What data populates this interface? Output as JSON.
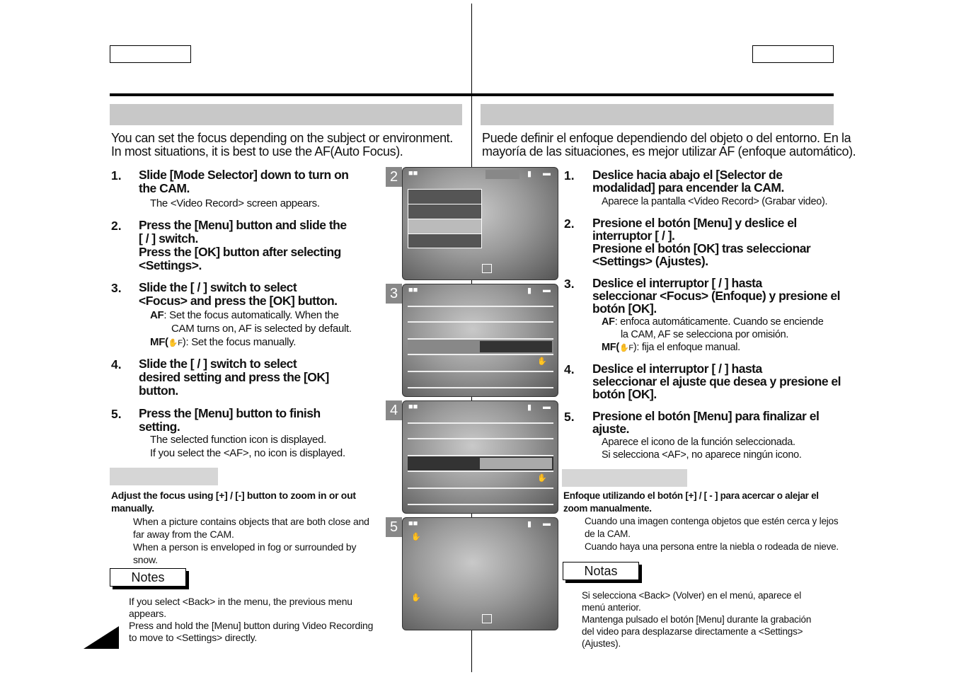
{
  "left": {
    "intro": "You can set the focus depending on the subject or environment.\nIn most situations, it is best to use the AF(Auto Focus).",
    "steps": [
      {
        "num": "1.",
        "text": "Slide [Mode Selector] down to turn on\nthe CAM.",
        "sub": "The <Video Record> screen appears."
      },
      {
        "num": "2.",
        "text": "Press the [Menu] button and slide the\n[    /    ] switch.\nPress the [OK] button after selecting\n<Settings>."
      },
      {
        "num": "3.",
        "text": "Slide the [    /    ] switch to select\n<Focus> and press the [OK] button.",
        "af_label": "AF",
        "af_text": ": Set the focus automatically. When the",
        "af_text2": "CAM turns on, AF is selected by default.",
        "mf_label": "MF(",
        "mf_text": "): Set the focus manually."
      },
      {
        "num": "4.",
        "text": "Slide the [    /    ] switch to select\ndesired setting and press the [OK]\nbutton."
      },
      {
        "num": "5.",
        "text": "Press the [Menu] button to finish\nsetting.",
        "sub": "The selected function icon is displayed.\nIf you select the <AF>, no icon is displayed."
      }
    ],
    "mf_heading": "Adjust the focus using [+] / [-] button to zoom in or out\nmanually.",
    "mf_items": "When a picture contains objects that are both close and\nfar away from the CAM.\nWhen a person is enveloped in fog or surrounded by\nsnow.",
    "notes_label": "Notes",
    "notes": "If you select <Back> in the menu, the previous menu\nappears.\nPress and hold the [Menu] button during Video Recording\nto move to <Settings> directly."
  },
  "right": {
    "intro": "Puede definir el enfoque dependiendo del objeto o del entorno. En la\nmayoría de las situaciones, es mejor utilizar AF (enfoque automático).",
    "steps": [
      {
        "num": "1.",
        "text": "Deslice hacia abajo el [Selector de\nmodalidad] para encender la CAM.",
        "sub": "Aparece la pantalla <Video Record> (Grabar video)."
      },
      {
        "num": "2.",
        "text": "Presione el botón [Menu] y deslice el\ninterruptor [    /    ].\nPresione el botón [OK] tras seleccionar\n<Settings> (Ajustes)."
      },
      {
        "num": "3.",
        "text": "Deslice el interruptor [    /    ] hasta\nseleccionar <Focus> (Enfoque) y presione el\nbotón [OK].",
        "af_label": "AF",
        "af_text": ": enfoca automáticamente. Cuando se enciende",
        "af_text2": "la CAM, AF se selecciona por omisión.",
        "mf_label": "MF(",
        "mf_text": "): fija el enfoque manual."
      },
      {
        "num": "4.",
        "text": "Deslice el interruptor [    /    ] hasta\nseleccionar el ajuste que desea y presione el\nbotón [OK]."
      },
      {
        "num": "5.",
        "text": "Presione el botón [Menu] para finalizar el\najuste.",
        "sub": "Aparece el icono de la función seleccionada.\nSi selecciona <AF>, no aparece ningún icono."
      }
    ],
    "mf_heading": "Enfoque utilizando el botón [+] / [ - ] para acercar o alejar el\nzoom manualmente.",
    "mf_items": "Cuando una imagen contenga objetos que estén cerca y lejos\nde la CAM.\nCuando haya una persona entre la niebla o rodeada de nieve.",
    "notes_label": "Notas",
    "notes": "Si selecciona <Back> (Volver) en el menú, aparece el\nmenú anterior.\nMantenga pulsado el botón [Menu] durante la grabación\ndel video para desplazarse directamente a <Settings>\n(Ajustes)."
  },
  "screens": [
    {
      "num": "2"
    },
    {
      "num": "3"
    },
    {
      "num": "4"
    },
    {
      "num": "5"
    }
  ],
  "screen_icons": {
    "mode": "video-camera-icon",
    "quality": "quality-icon",
    "battery": "battery-icon",
    "focus": "manual-focus-hand-icon"
  },
  "mf_icon_letter": "F",
  "colors": {
    "header_bar": "#c8c8c8",
    "screen_menu": "#555555",
    "screen_highlight": "#bbbbbb",
    "tab": "#888888"
  }
}
